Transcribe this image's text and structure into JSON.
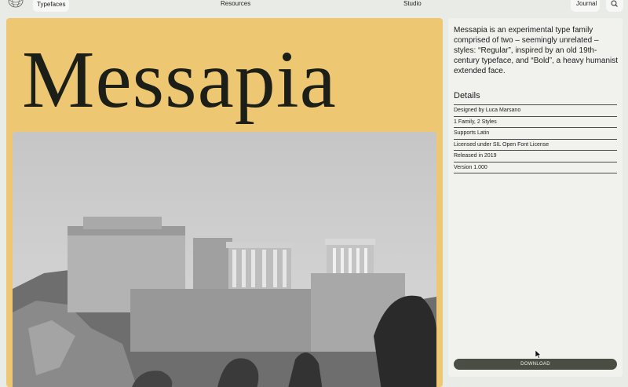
{
  "nav": {
    "typefaces": "Typefaces",
    "resources": "Resources",
    "studio": "Studio",
    "journal": "Journal",
    "logo_icon": "globe-logo",
    "search_icon": "search-icon"
  },
  "hero": {
    "title": "Messapia",
    "background": "#eec773",
    "photo": "acropolis-photo"
  },
  "info": {
    "description": "Messapia is an experimental type family comprised of two – seemingly unrelated – styles: “Regular”, inspired by an old 19th-century typeface, and “Bold”, a heavy humanist extended face.",
    "details_heading": "Details",
    "details": [
      "Designed by Luca Marsano",
      "1 Family, 2 Styles",
      "Supports Latin",
      "Licensed under SIL Open Font License",
      "Released in 2019",
      "Version 1.000"
    ],
    "download_label": "DOWNLOAD"
  }
}
